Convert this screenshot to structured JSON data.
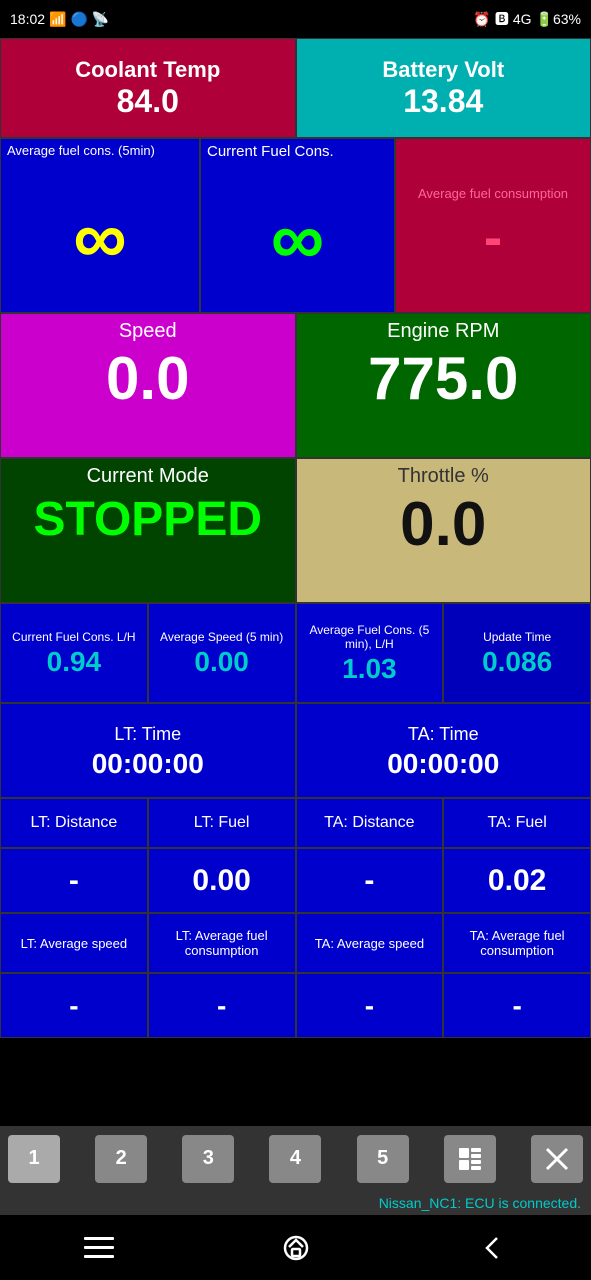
{
  "statusBar": {
    "time": "18:02",
    "icons": [
      "wifi",
      "bluetooth",
      "signal",
      "4g",
      "4gr",
      "battery"
    ],
    "batteryLevel": "63"
  },
  "coolantTemp": {
    "title": "Coolant Temp",
    "value": "84.0"
  },
  "batteryVolt": {
    "title": "Battery Volt",
    "value": "13.84"
  },
  "avgFuelCons": {
    "label": "Average fuel cons. (5min)",
    "value": "∞"
  },
  "currentFuelCons": {
    "label": "Current Fuel Cons.",
    "value": "∞"
  },
  "avgFuelConsRight": {
    "label": "Average fuel consumption",
    "value": "-"
  },
  "speed": {
    "title": "Speed",
    "value": "0.0"
  },
  "engineRPM": {
    "title": "Engine RPM",
    "value": "775.0"
  },
  "currentMode": {
    "title": "Current Mode",
    "value": "STOPPED"
  },
  "throttle": {
    "title": "Throttle %",
    "value": "0.0"
  },
  "stats": {
    "currentFuelConsLH": {
      "label": "Current Fuel Cons. L/H",
      "value": "0.94"
    },
    "avgSpeed5min": {
      "label": "Average Speed (5 min)",
      "value": "0.00"
    },
    "avgFuelCons5min": {
      "label": "Average Fuel Cons. (5 min), L/H",
      "value": "1.03"
    },
    "updateTime": {
      "label": "Update Time",
      "value": "0.086"
    }
  },
  "ltTime": {
    "title": "LT: Time",
    "value": "00:00:00"
  },
  "taTime": {
    "title": "TA: Time",
    "value": "00:00:00"
  },
  "ltDistance": {
    "label": "LT: Distance",
    "value": "-"
  },
  "ltFuel": {
    "label": "LT: Fuel",
    "value": "0.00"
  },
  "taDistance": {
    "label": "TA: Distance",
    "value": "-"
  },
  "taFuel": {
    "label": "TA: Fuel",
    "value": "0.02"
  },
  "ltAvgSpeed": {
    "label": "LT: Average speed",
    "value": "-"
  },
  "ltAvgFuelCons": {
    "label": "LT: Average fuel consumption",
    "value": "-"
  },
  "taAvgSpeed": {
    "label": "TA: Average speed",
    "value": "-"
  },
  "taAvgFuelCons": {
    "label": "TA: Average fuel consumption",
    "value": "-"
  },
  "navButtons": {
    "btn1": "1",
    "btn2": "2",
    "btn3": "3",
    "btn4": "4",
    "btn5": "5"
  },
  "statusMessage": "Nissan_NC1: ECU is connected."
}
